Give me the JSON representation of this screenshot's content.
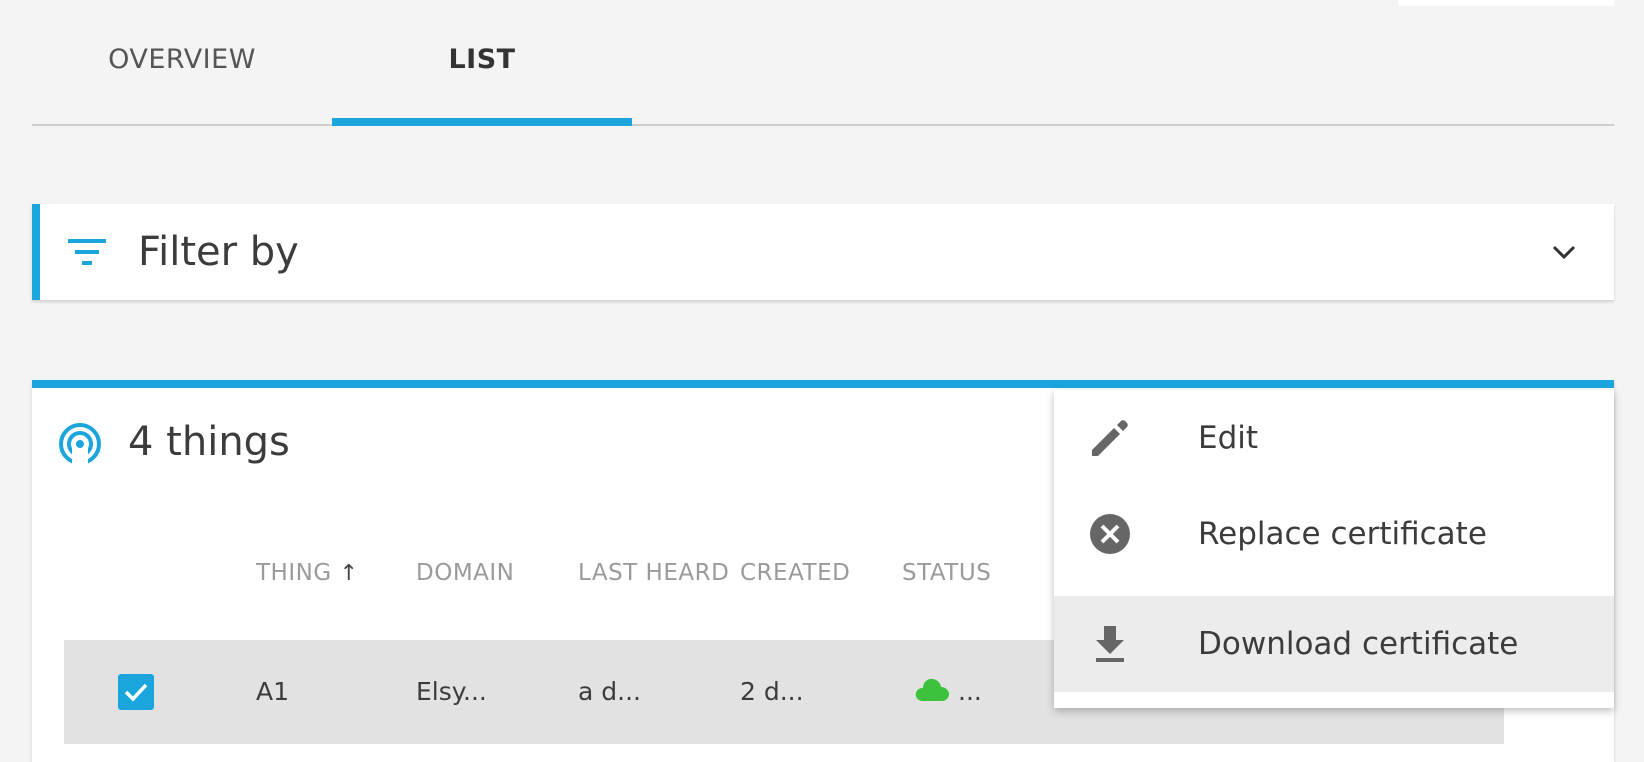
{
  "tabs": {
    "overview": "OVERVIEW",
    "list": "LIST",
    "active": "list"
  },
  "filter": {
    "label": "Filter by",
    "icon": "filter-icon",
    "toggle_icon": "chevron-down-icon"
  },
  "things": {
    "title": "4 things",
    "icon": "signal-icon",
    "columns": {
      "thing": "THING",
      "sort_arrow": "↑",
      "domain": "DOMAIN",
      "last_heard": "LAST HEARD",
      "created": "CREATED",
      "status": "STATUS"
    },
    "rows": [
      {
        "selected": true,
        "thing": "A1",
        "domain": "Elsy...",
        "last_heard": "a d...",
        "created": "2 d...",
        "status_icon": "cloud-icon",
        "status_color": "#3cc23c",
        "status_text": "..."
      }
    ]
  },
  "menu": {
    "items": [
      {
        "label": "Edit",
        "icon": "pencil-icon"
      },
      {
        "label": "Replace certificate",
        "icon": "cancel-circle-icon"
      },
      {
        "label": "Download certificate",
        "icon": "download-icon",
        "highlighted": true
      }
    ]
  },
  "colors": {
    "accent": "#1aa6dd",
    "background": "#f4f4f4",
    "status_online": "#3cc23c"
  }
}
